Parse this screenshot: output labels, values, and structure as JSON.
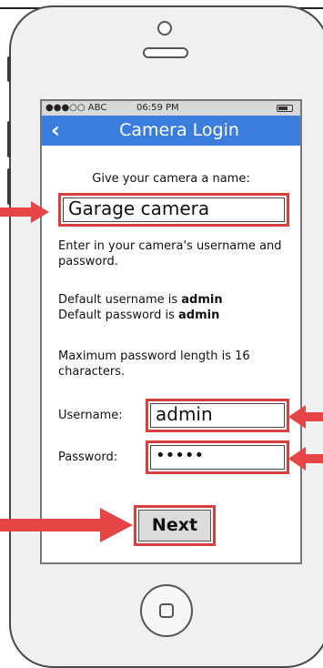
{
  "status_bar": {
    "carrier": "●●●○○ ABC",
    "time": "06:59 PM"
  },
  "nav": {
    "back_icon": "‹",
    "title": "Camera Login"
  },
  "form": {
    "name_prompt": "Give your camera a name:",
    "camera_name_value": "Garage camera",
    "instructions": "Enter in your camera's username and password.",
    "default_user_prefix": "Default username is ",
    "default_user_value": "admin",
    "default_pass_prefix": "Default password is ",
    "default_pass_value": "admin",
    "max_length_note": "Maximum password length is 16 characters.",
    "username_label": "Username:",
    "username_value": "admin",
    "password_label": "Password:",
    "password_value": "•••••",
    "next_label": "Next"
  },
  "colors": {
    "accent": "#3b7ddd",
    "highlight": "#d84040",
    "arrow": "#e64545"
  },
  "icons": [
    "back-chevron-icon",
    "battery-icon",
    "home-button-icon",
    "callout-arrow-icon"
  ]
}
